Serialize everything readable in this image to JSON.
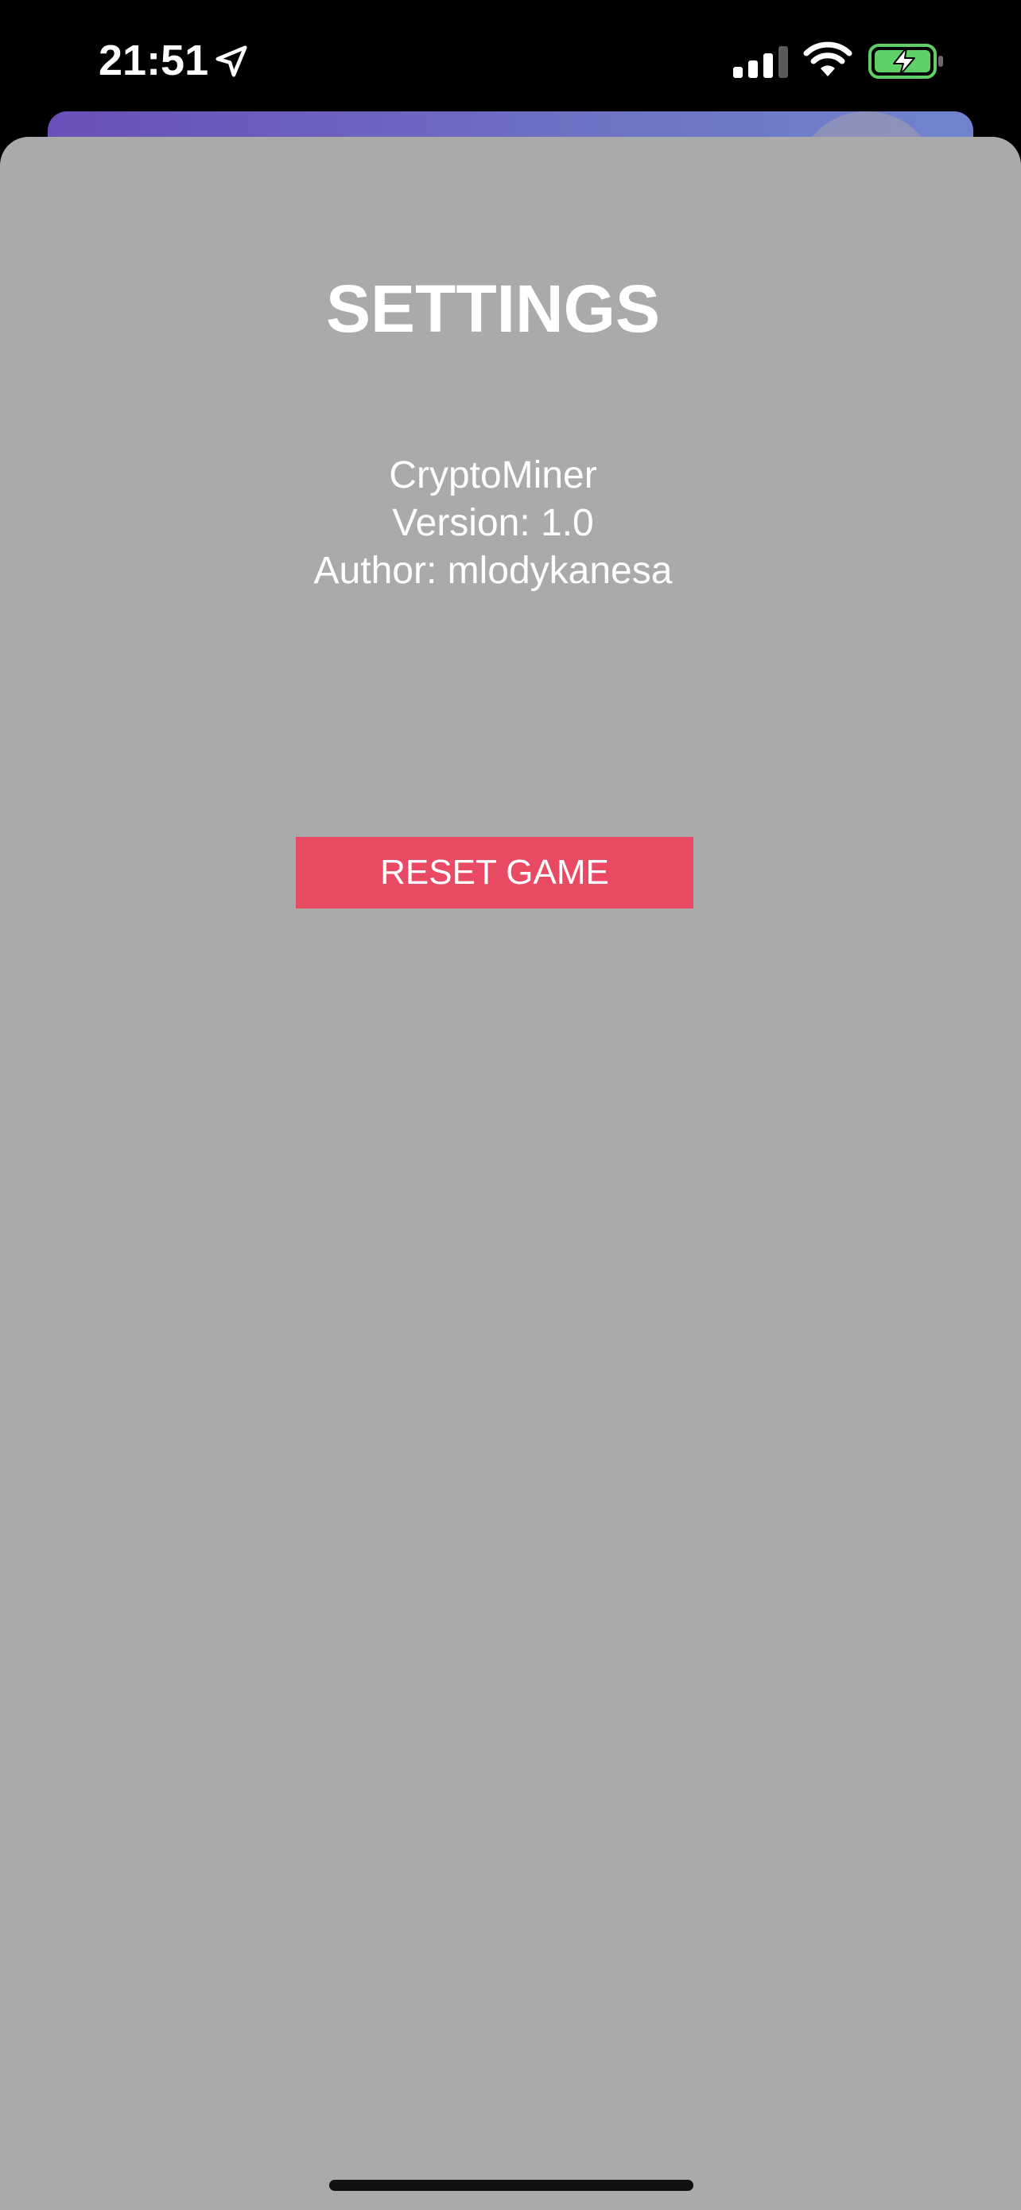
{
  "status_bar": {
    "time": "21:51",
    "icons": [
      "location-arrow-icon",
      "cellular-signal-icon",
      "wifi-icon",
      "battery-charging-icon"
    ],
    "battery_color": "#5fd068"
  },
  "settings": {
    "title": "SETTINGS",
    "app_name": "CryptoMiner",
    "version": "Version: 1.0",
    "author": "Author: mlodykanesa",
    "reset_label": "RESET GAME",
    "reset_color": "#e84a64",
    "sheet_color": "#aaaaaa"
  }
}
